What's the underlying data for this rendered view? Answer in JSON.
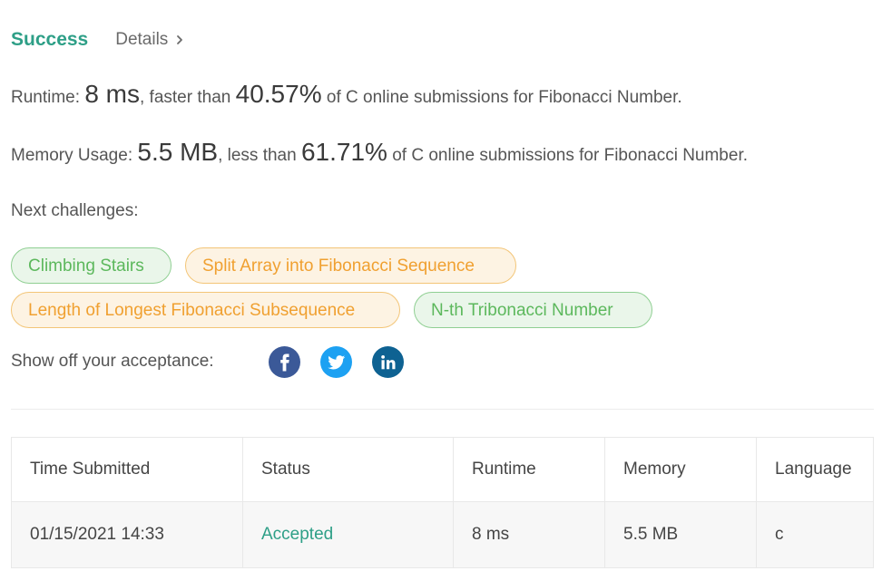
{
  "header": {
    "status_label": "Success",
    "details_label": "Details"
  },
  "runtime": {
    "prefix": "Runtime: ",
    "value": "8 ms",
    "middle": ", faster than ",
    "percent": "40.57%",
    "suffix": " of C online submissions for Fibonacci Number."
  },
  "memory": {
    "prefix": "Memory Usage: ",
    "value": "5.5 MB",
    "middle": ", less than ",
    "percent": "61.71%",
    "suffix": " of C online submissions for Fibonacci Number."
  },
  "next_challenges": {
    "label": "Next challenges:",
    "items": [
      {
        "label": "Climbing Stairs",
        "color": "#5cb85c"
      },
      {
        "label": "Split Array into Fibonacci Sequence",
        "color": "#f0a030"
      },
      {
        "label": "Length of Longest Fibonacci Subsequence",
        "color": "#f0a030"
      },
      {
        "label": "N-th Tribonacci Number",
        "color": "#5cb85c"
      }
    ]
  },
  "share": {
    "label": "Show off your acceptance:",
    "icons": [
      "facebook-icon",
      "twitter-icon",
      "linkedin-icon"
    ]
  },
  "table": {
    "columns": [
      "Time Submitted",
      "Status",
      "Runtime",
      "Memory",
      "Language"
    ],
    "rows": [
      [
        "01/15/2021 14:33",
        "Accepted",
        "8 ms",
        "5.5 MB",
        "c"
      ]
    ]
  },
  "colors": {
    "success": "#2e9f87",
    "facebook": "#3b5998",
    "twitter": "#1da1f2",
    "linkedin": "#0e6292"
  }
}
